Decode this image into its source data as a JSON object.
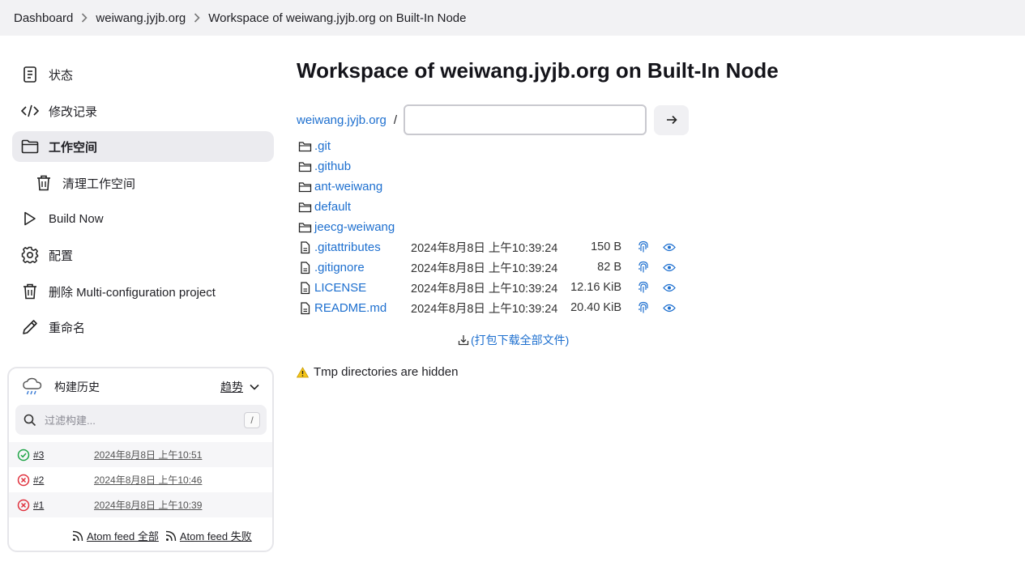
{
  "breadcrumb": {
    "items": [
      "Dashboard",
      "weiwang.jyjb.org",
      "Workspace of weiwang.jyjb.org on Built-In Node"
    ]
  },
  "sidebar": {
    "items": [
      {
        "label": "状态",
        "icon": "document-icon"
      },
      {
        "label": "修改记录",
        "icon": "code-icon"
      },
      {
        "label": "工作空间",
        "icon": "folder-icon"
      },
      {
        "label": "清理工作空间",
        "icon": "trash-icon"
      },
      {
        "label": "Build Now",
        "icon": "play-icon"
      },
      {
        "label": "配置",
        "icon": "gear-icon"
      },
      {
        "label": "删除 Multi-configuration project",
        "icon": "trash-icon"
      },
      {
        "label": "重命名",
        "icon": "pencil-icon"
      }
    ]
  },
  "history": {
    "title": "构建历史",
    "trend_label": "趋势",
    "filter_placeholder": "过滤构建...",
    "filter_shortcut": "/",
    "builds": [
      {
        "number": "#3",
        "time": "2024年8月8日 上午10:51",
        "status": "success"
      },
      {
        "number": "#2",
        "time": "2024年8月8日 上午10:46",
        "status": "failed"
      },
      {
        "number": "#1",
        "time": "2024年8月8日 上午10:39",
        "status": "failed"
      }
    ],
    "feed_all": "Atom feed 全部",
    "feed_failed": "Atom feed 失败"
  },
  "main": {
    "title": "Workspace of weiwang.jyjb.org on Built-In Node",
    "path_root": "weiwang.jyjb.org",
    "path_separator": "/",
    "path_input_value": "",
    "directories": [
      ".git",
      ".github",
      "ant-weiwang",
      "default",
      "jeecg-weiwang"
    ],
    "files": [
      {
        "name": ".gitattributes",
        "date": "2024年8月8日 上午10:39:24",
        "size": "150 B"
      },
      {
        "name": ".gitignore",
        "date": "2024年8月8日 上午10:39:24",
        "size": "82 B"
      },
      {
        "name": "LICENSE",
        "date": "2024年8月8日 上午10:39:24",
        "size": "12.16 KiB"
      },
      {
        "name": "README.md",
        "date": "2024年8月8日 上午10:39:24",
        "size": "20.40 KiB"
      }
    ],
    "zip_link": "(打包下载全部文件)",
    "notice": "Tmp directories are hidden"
  },
  "colors": {
    "link": "#1d6fcf",
    "success": "#1ea446",
    "failure": "#e0323e",
    "warning": "#f5c518",
    "active_bg": "#ebebef"
  }
}
